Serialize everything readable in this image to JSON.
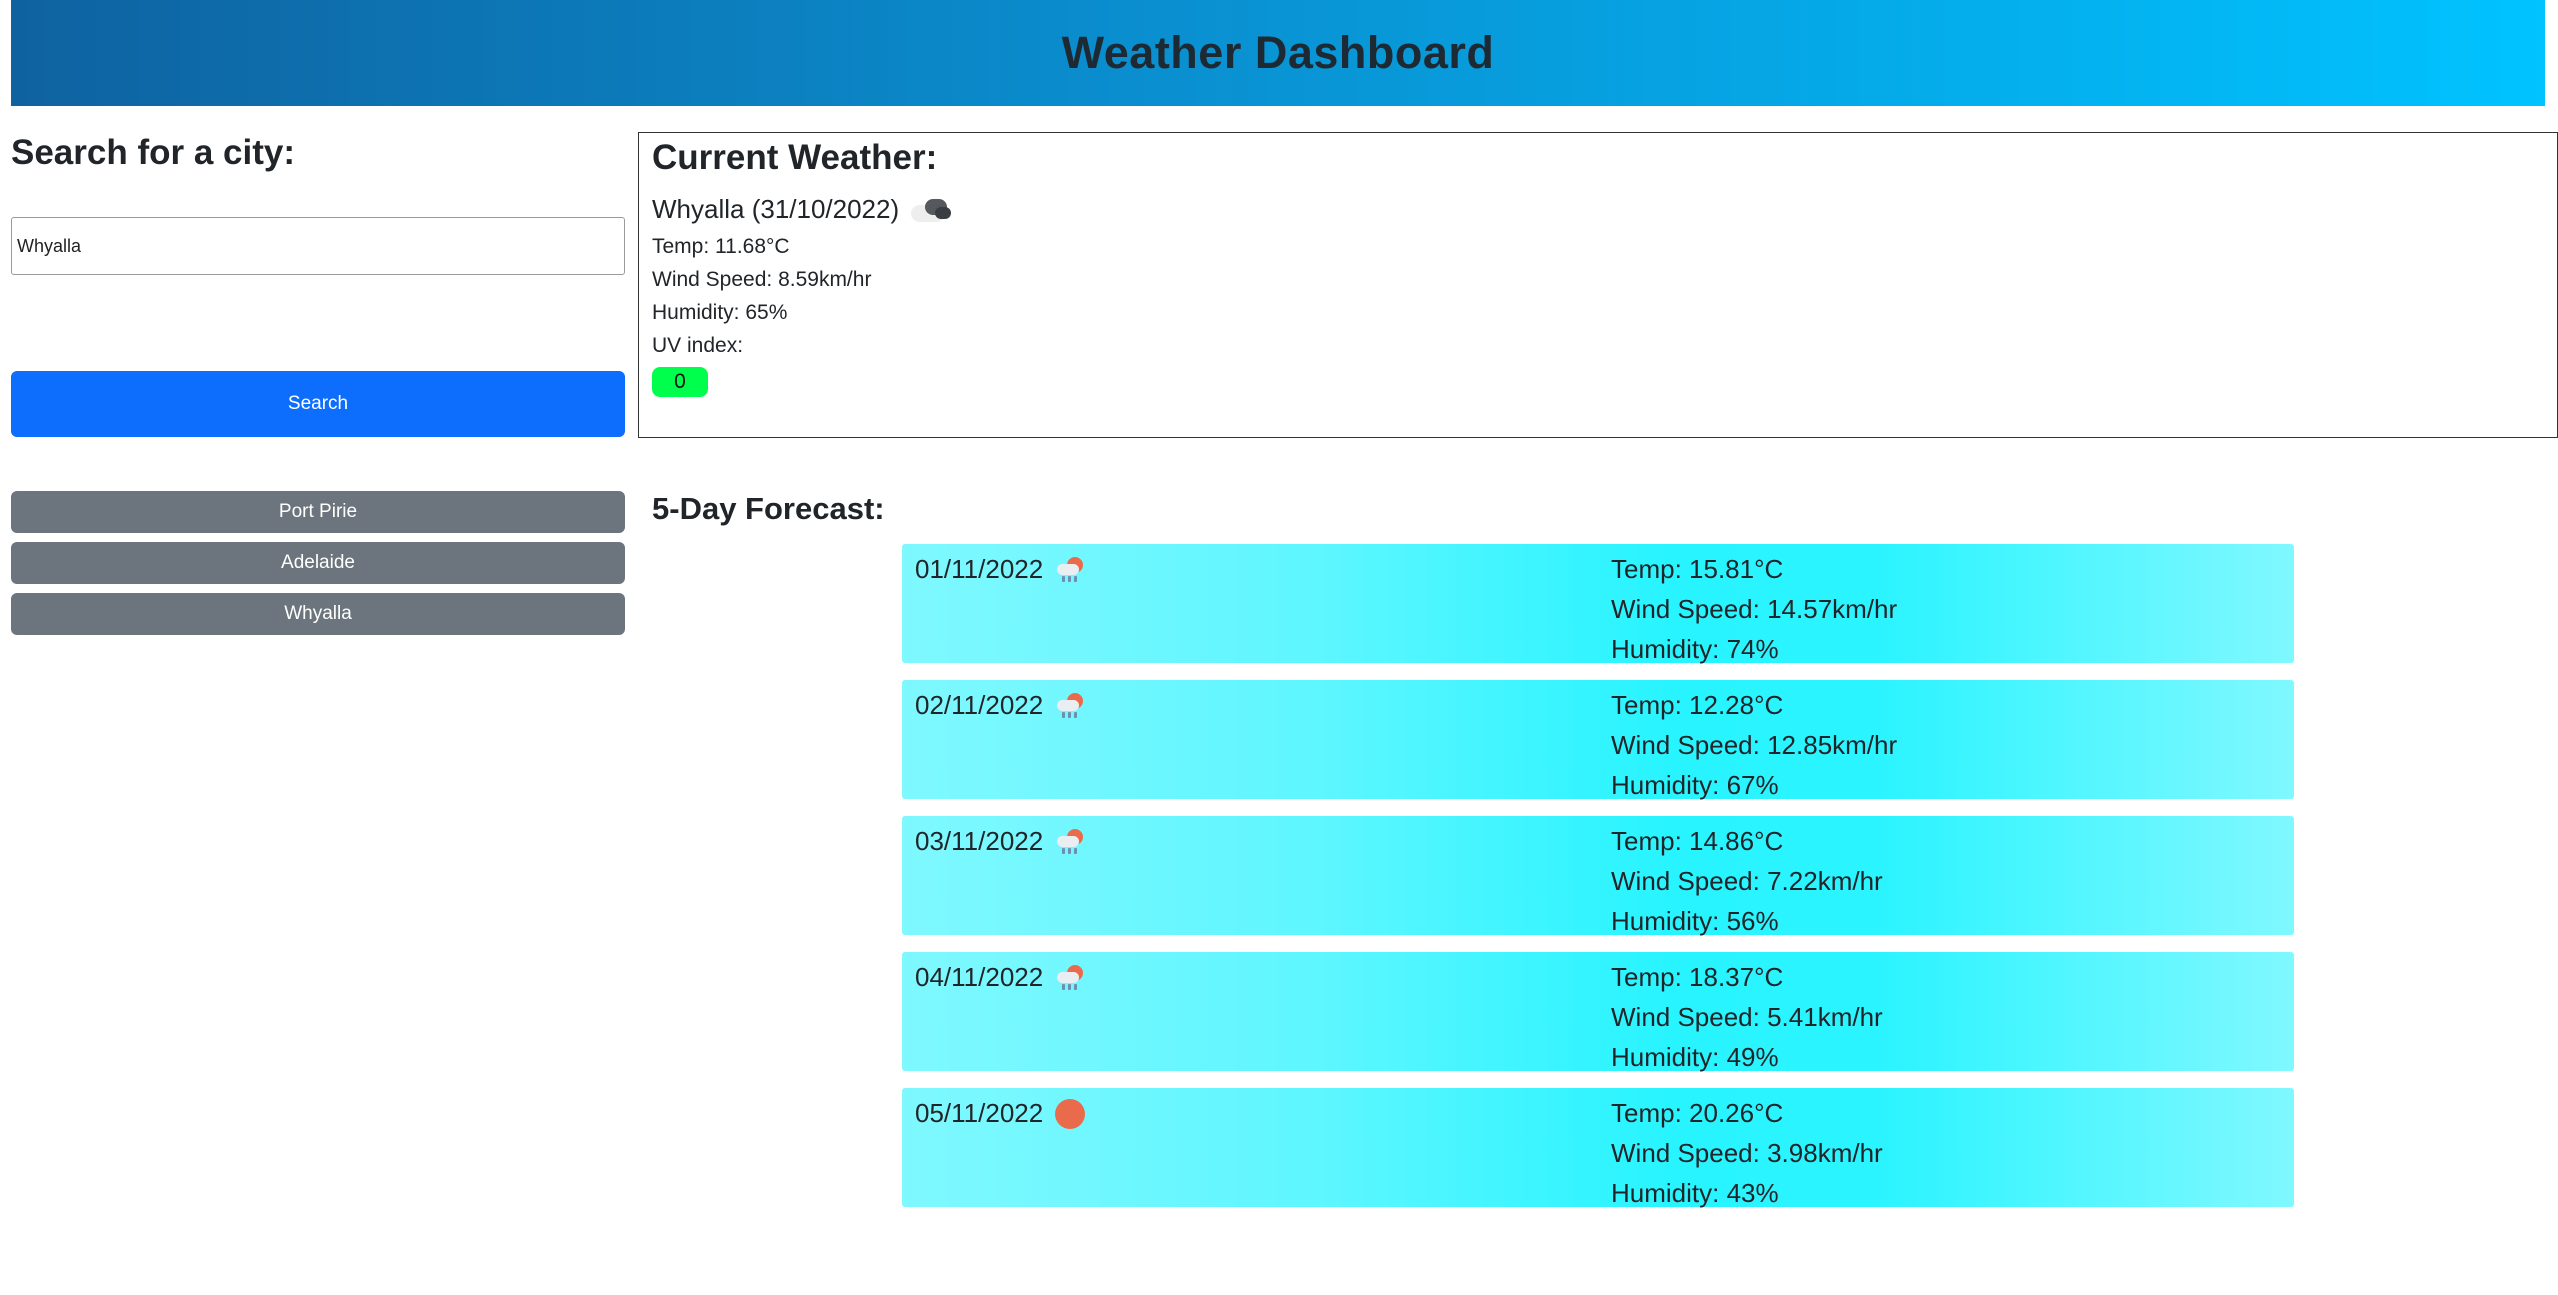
{
  "header": {
    "title": "Weather Dashboard"
  },
  "search": {
    "heading": "Search for a city:",
    "value": "Whyalla",
    "button_label": "Search",
    "history": [
      "Port Pirie",
      "Adelaide",
      "Whyalla"
    ]
  },
  "current": {
    "title": "Current Weather:",
    "city_date": "Whyalla (31/10/2022)",
    "icon": "cloud-icon",
    "temp": "Temp: 11.68°C",
    "wind": "Wind Speed: 8.59km/hr",
    "humidity": "Humidity: 65%",
    "uv_label": "UV index:",
    "uv_value": "0",
    "uv_color": "#00ff4c"
  },
  "forecast": {
    "title": "5-Day Forecast:",
    "days": [
      {
        "date": "01/11/2022",
        "icon": "rain-icon",
        "temp": "Temp: 15.81°C",
        "wind": "Wind Speed: 14.57km/hr",
        "humidity": "Humidity: 74%"
      },
      {
        "date": "02/11/2022",
        "icon": "rain-icon",
        "temp": "Temp: 12.28°C",
        "wind": "Wind Speed: 12.85km/hr",
        "humidity": "Humidity: 67%"
      },
      {
        "date": "03/11/2022",
        "icon": "rain-icon",
        "temp": "Temp: 14.86°C",
        "wind": "Wind Speed: 7.22km/hr",
        "humidity": "Humidity: 56%"
      },
      {
        "date": "04/11/2022",
        "icon": "rain-icon",
        "temp": "Temp: 18.37°C",
        "wind": "Wind Speed: 5.41km/hr",
        "humidity": "Humidity: 49%"
      },
      {
        "date": "05/11/2022",
        "icon": "sun-icon",
        "temp": "Temp: 20.26°C",
        "wind": "Wind Speed: 3.98km/hr",
        "humidity": "Humidity: 43%"
      }
    ]
  },
  "colors": {
    "header_start": "#0f62a0",
    "header_end": "#00c3ff",
    "search_button": "#0d6efd",
    "history_button": "#6c757d",
    "forecast_card": "#28f4ff"
  }
}
